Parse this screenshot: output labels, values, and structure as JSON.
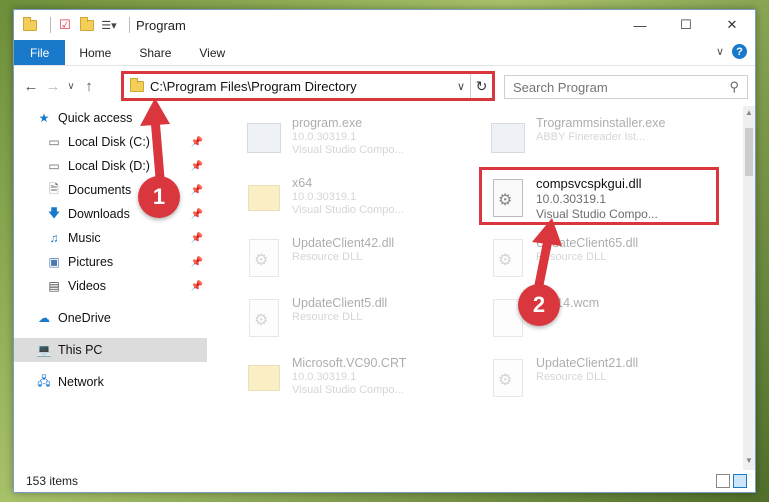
{
  "window": {
    "title": "Program",
    "minimize": "—",
    "maximize": "☐",
    "close": "✕"
  },
  "ribbon": {
    "tabs": [
      {
        "label": "File"
      },
      {
        "label": "Home"
      },
      {
        "label": "Share"
      },
      {
        "label": "View"
      }
    ],
    "collapse": "∨",
    "help": "?"
  },
  "address": {
    "path": "C:\\Program Files\\Program Directory",
    "back": "←",
    "forward": "→",
    "recent": "∨",
    "up": "↑",
    "dropdown": "∨",
    "refresh": "↻"
  },
  "search": {
    "placeholder": "Search Program"
  },
  "nav": {
    "quick_access": "Quick access",
    "items": [
      {
        "label": "Local Disk (C:)"
      },
      {
        "label": "Local Disk (D:)"
      },
      {
        "label": "Documents"
      },
      {
        "label": "Downloads"
      },
      {
        "label": "Music"
      },
      {
        "label": "Pictures"
      },
      {
        "label": "Videos"
      }
    ],
    "onedrive": "OneDrive",
    "this_pc": "This PC",
    "network": "Network"
  },
  "files": [
    {
      "name": "program.exe",
      "meta1": "10.0.30319.1",
      "meta2": "Visual Studio Compo..."
    },
    {
      "name": "Trogrammsinstaller.exe",
      "meta1": "ABBY Finereader Ist...",
      "meta2": ""
    },
    {
      "name": "x64",
      "meta1": "10.0.30319.1",
      "meta2": "Visual Studio Compo..."
    },
    {
      "name": "compsvcspkgui.dll",
      "meta1": "10.0.30319.1",
      "meta2": "Visual Studio Compo..."
    },
    {
      "name": "UpdateClient42.dll",
      "meta1": "Resource DLL",
      "meta2": ""
    },
    {
      "name": "UpdateClient65.dll",
      "meta1": "Resource DLL",
      "meta2": ""
    },
    {
      "name": "UpdateClient5.dll",
      "meta1": "Resource DLL",
      "meta2": ""
    },
    {
      "name": "WP14.wcm",
      "meta1": "File",
      "meta2": ""
    },
    {
      "name": "Microsoft.VC90.CRT",
      "meta1": "10.0.30319.1",
      "meta2": "Visual Studio Compo..."
    },
    {
      "name": "UpdateClient21.dll",
      "meta1": "Resource DLL",
      "meta2": ""
    }
  ],
  "status": {
    "count": "153 items"
  },
  "markers": {
    "one": "1",
    "two": "2"
  },
  "colors": {
    "accent": "#1979ca",
    "highlight": "#d9363e"
  }
}
